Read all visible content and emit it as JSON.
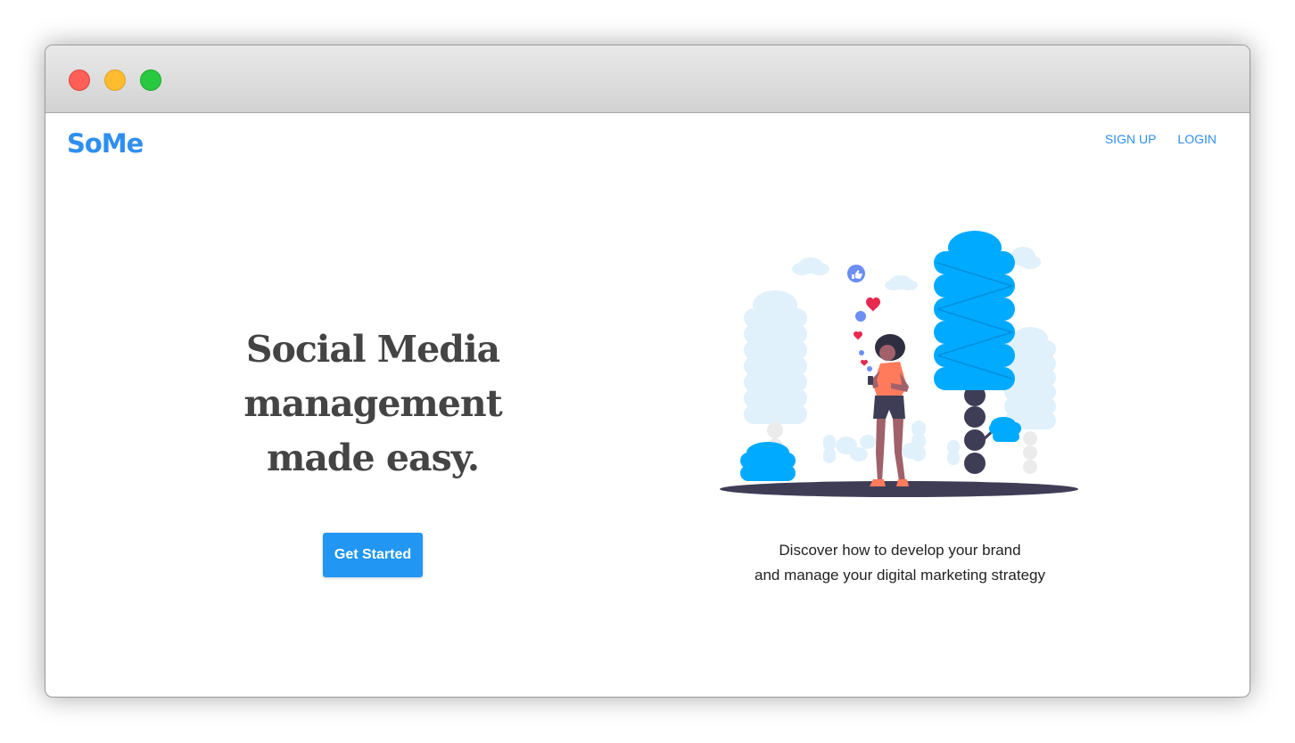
{
  "window": {
    "controls": [
      "close",
      "minimize",
      "maximize"
    ]
  },
  "header": {
    "logo": "SoMe",
    "nav": [
      {
        "label": "SIGN UP"
      },
      {
        "label": "LOGIN"
      }
    ]
  },
  "hero": {
    "headline_lines": [
      "Social Media",
      "management",
      "made easy."
    ],
    "cta_label": "Get Started",
    "tagline_lines": [
      "Discover how to develop your brand",
      "and manage your digital marketing strategy"
    ],
    "illustration": "woman-with-phone-among-trees-illustration"
  },
  "colors": {
    "brand": "#2f8ef0",
    "button": "#2196f3",
    "headline": "#444444",
    "tree_blue": "#00aaff",
    "tree_light": "#e1f1fb",
    "ground": "#3f3d56",
    "heart": "#e8294f",
    "shirt": "#ff7b5c"
  }
}
